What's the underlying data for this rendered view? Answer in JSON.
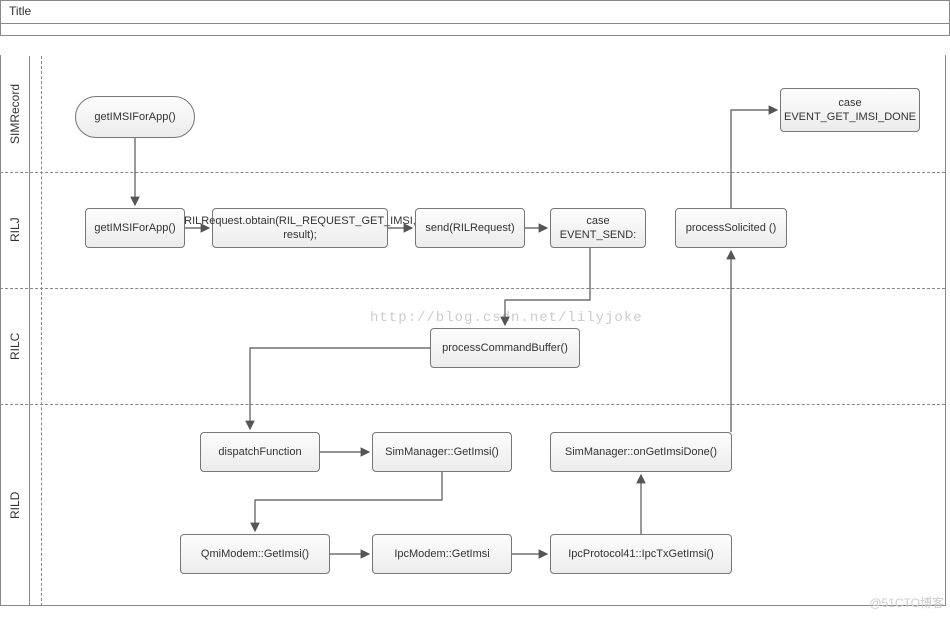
{
  "title": "Title",
  "watermark": "http://blog.csdn.net/lilyjoke",
  "credit": "@51CTO博客",
  "lanes": {
    "sim": "SIMRecord",
    "rilj": "RILJ",
    "rilc": "RILC",
    "rild": "RILD"
  },
  "nodes": {
    "n1": "getIMSIForApp()",
    "n2": "getIMSIForApp()",
    "n3": "RILRequest.obtain(RIL_REQUEST_GET_IMSI, result);",
    "n4": "send(RILRequest)",
    "n5": "case EVENT_SEND:",
    "n6": "processSolicited ()",
    "n7": "case EVENT_GET_IMSI_DONE",
    "n8": "processCommandBuffer()",
    "n9": "dispatchFunction",
    "n10": "SimManager::GetImsi()",
    "n11": "SimManager::onGetImsiDone()",
    "n12": "QmiModem::GetImsi()",
    "n13": "IpcModem::GetImsi",
    "n14": "IpcProtocol41::IpcTxGetImsi()"
  }
}
